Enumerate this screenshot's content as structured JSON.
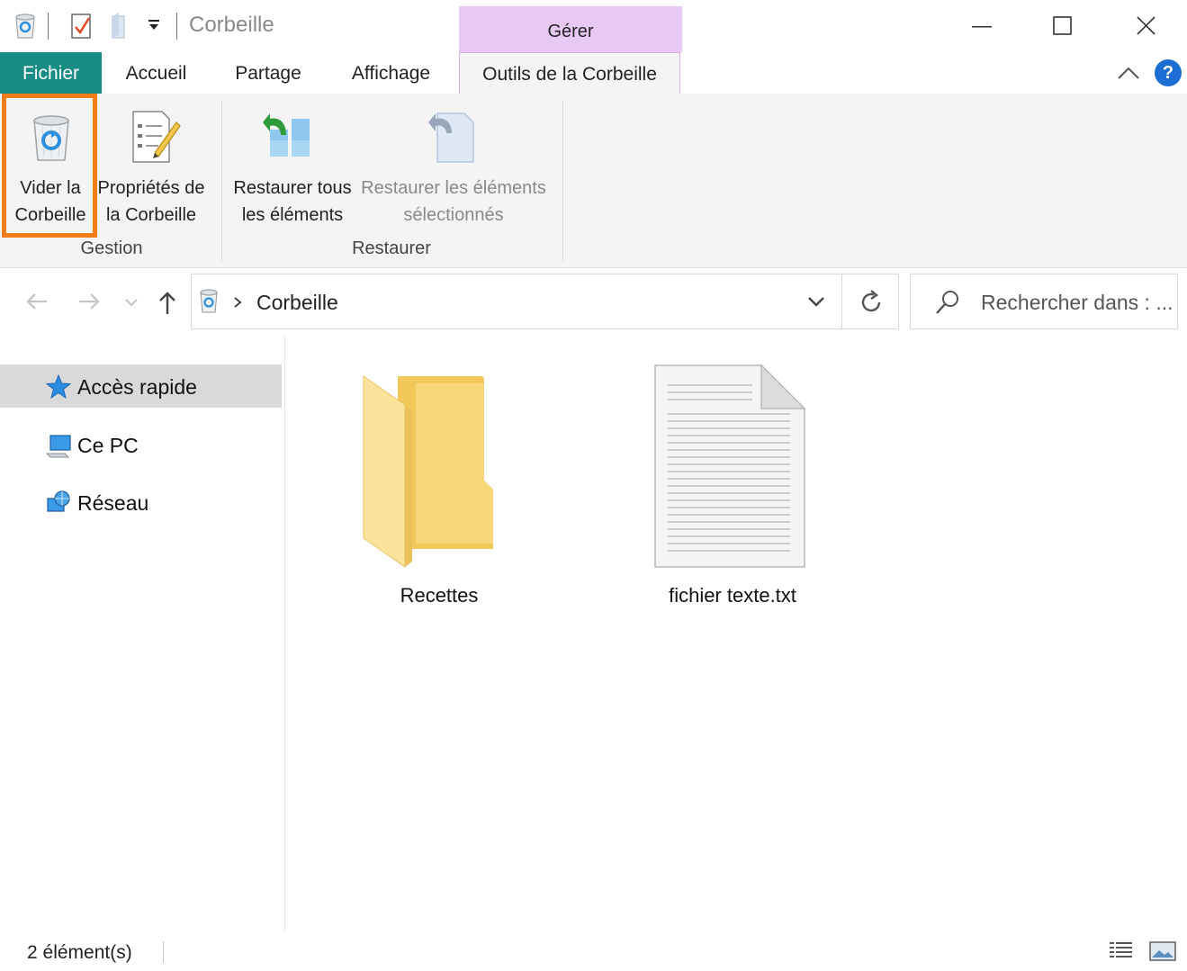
{
  "window": {
    "title": "Corbeille",
    "context_tab_group": "Gérer",
    "minimize_icon": "minimize-icon",
    "maximize_icon": "maximize-icon",
    "close_icon": "close-icon"
  },
  "tabs": [
    {
      "label": "Fichier"
    },
    {
      "label": "Accueil"
    },
    {
      "label": "Partage"
    },
    {
      "label": "Affichage"
    },
    {
      "label": "Outils de la Corbeille"
    }
  ],
  "ribbon": {
    "groups": [
      {
        "label": "Gestion"
      },
      {
        "label": "Restaurer"
      }
    ],
    "buttons": {
      "empty_bin": {
        "line1": "Vider la",
        "line2": "Corbeille"
      },
      "bin_properties": {
        "line1": "Propriétés de",
        "line2": "la Corbeille"
      },
      "restore_all": {
        "line1": "Restaurer tous",
        "line2": "les éléments"
      },
      "restore_selected": {
        "line1": "Restaurer les éléments",
        "line2": "sélectionnés"
      }
    },
    "highlight_color": "#f57c13"
  },
  "address": {
    "path": "Corbeille"
  },
  "search": {
    "placeholder": "Rechercher dans : ..."
  },
  "nav": {
    "items": [
      {
        "label": "Accès rapide"
      },
      {
        "label": "Ce PC"
      },
      {
        "label": "Réseau"
      }
    ]
  },
  "content": {
    "items": [
      {
        "name": "Recettes",
        "icon": "folder-icon"
      },
      {
        "name": "fichier texte.txt",
        "icon": "text-file-icon"
      }
    ]
  },
  "status": {
    "count": "2 élément(s)"
  },
  "colors": {
    "file_tab": "#1a8c86",
    "manage_tab": "#e8c9f5",
    "help": "#1c6ed5"
  }
}
